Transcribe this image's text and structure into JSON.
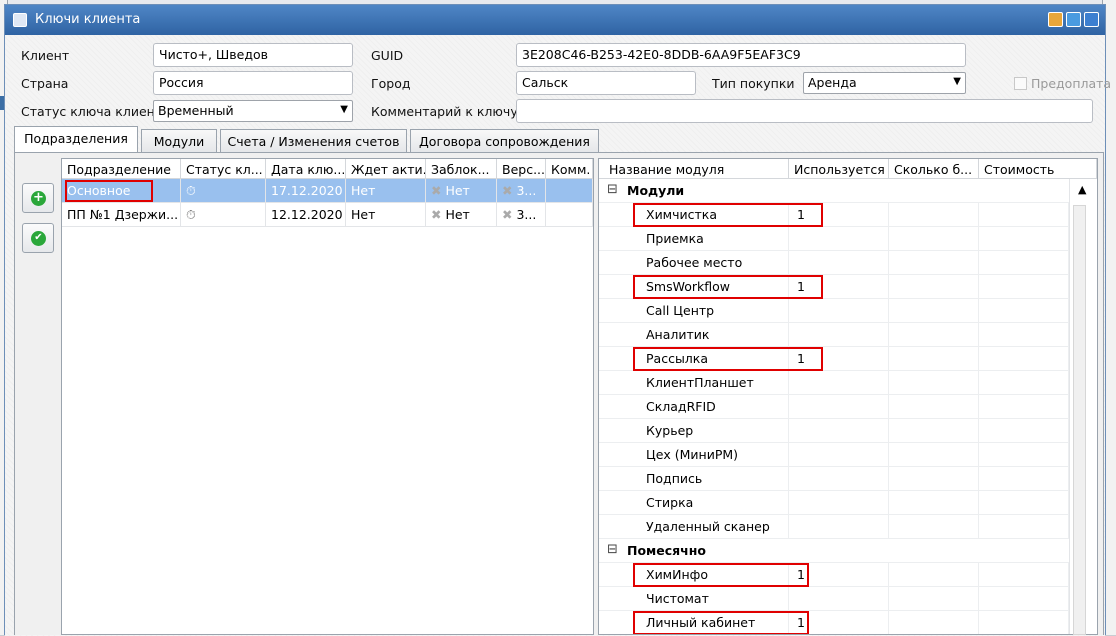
{
  "window": {
    "title": "Ключи клиента"
  },
  "form": {
    "client_label": "Клиент",
    "client_value": "Чисто+, Шведов",
    "guid_label": "GUID",
    "guid_value": "3E208C46-B253-42E0-8DDB-6AA9F5EAF3C9",
    "country_label": "Страна",
    "country_value": "Россия",
    "city_label": "Город",
    "city_value": "Сальск",
    "purchase_type_label": "Тип покупки",
    "purchase_type_value": "Аренда",
    "prepay_label": "Предоплата",
    "status_label": "Статус ключа клиента",
    "status_value": "Временный",
    "comment_label": "Комментарий к ключу",
    "comment_value": ""
  },
  "tabs": [
    {
      "label": "Подразделения",
      "active": true
    },
    {
      "label": "Модули",
      "active": false
    },
    {
      "label": "Счета / Изменения счетов",
      "active": false
    },
    {
      "label": "Договора сопровождения",
      "active": false
    }
  ],
  "divisions": {
    "columns": [
      "Подразделение",
      "Статус кл...",
      "Дата клю...",
      "Ждет акти...",
      "Заблок...",
      "Верс...",
      "Комм."
    ],
    "rows": [
      {
        "name": "Основное",
        "status_icon": "stopwatch-icon",
        "date": "17.12.2020",
        "waiting": "Нет",
        "blocked": "Нет",
        "version": "3...",
        "comment": "",
        "selected": true
      },
      {
        "name": "ПП №1 Дзержи...",
        "status_icon": "stopwatch-icon",
        "date": "12.12.2020",
        "waiting": "Нет",
        "blocked": "Нет",
        "version": "3...",
        "comment": "",
        "selected": false
      }
    ]
  },
  "modules": {
    "columns": [
      "Название модуля",
      "Используется",
      "Сколько б...",
      "Стоимость"
    ],
    "groups": [
      {
        "name": "Модули",
        "items": [
          {
            "name": "Химчистка",
            "used": "1"
          },
          {
            "name": "Приемка",
            "used": ""
          },
          {
            "name": "Рабочее место",
            "used": ""
          },
          {
            "name": "SmsWorkflow",
            "used": "1"
          },
          {
            "name": "Call Центр",
            "used": ""
          },
          {
            "name": "Аналитик",
            "used": ""
          },
          {
            "name": "Рассылка",
            "used": "1"
          },
          {
            "name": "КлиентПланшет",
            "used": ""
          },
          {
            "name": "СкладRFID",
            "used": ""
          },
          {
            "name": "Курьер",
            "used": ""
          },
          {
            "name": "Цех (МиниPM)",
            "used": ""
          },
          {
            "name": "Подпись",
            "used": ""
          },
          {
            "name": "Стирка",
            "used": ""
          },
          {
            "name": "Удаленный сканер",
            "used": ""
          }
        ]
      },
      {
        "name": "Помесячно",
        "items": [
          {
            "name": "ХимИнфо",
            "used": "1"
          },
          {
            "name": "Чистомат",
            "used": ""
          },
          {
            "name": "Личный кабинет",
            "used": "1"
          }
        ]
      }
    ]
  },
  "colors": {
    "title_bar": "#2f63a3",
    "selection": "#99c0ee",
    "highlight_box": "#e00000",
    "add_button": "#2aa73a"
  }
}
